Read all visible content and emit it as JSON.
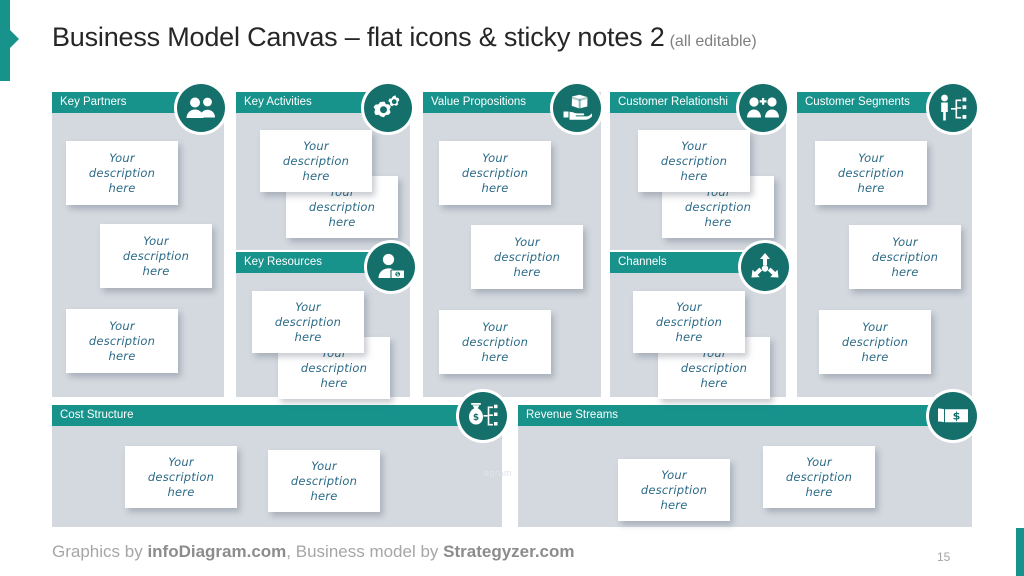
{
  "title": {
    "main": "Business Model Canvas – flat icons & sticky notes 2",
    "sub": "(all editable)"
  },
  "note_text": {
    "line1": "Your",
    "line2": "description",
    "line3": "here"
  },
  "colors": {
    "header_teal": "#18938c",
    "icon_teal": "#15706c",
    "block_gray": "#d4d9e0",
    "note_text": "#2b6a86",
    "title": "#262626",
    "footer": "#a6a6a6"
  },
  "blocks": [
    {
      "id": "key-partners",
      "label": "Key Partners",
      "icon": "two-people-icon"
    },
    {
      "id": "key-activities",
      "label": "Key Activities",
      "icon": "gears-icon"
    },
    {
      "id": "key-resources",
      "label": "Key Resources",
      "icon": "person-money-icon"
    },
    {
      "id": "value-propositions",
      "label": "Value Propositions",
      "icon": "hand-gift-box-icon"
    },
    {
      "id": "customer-relationships",
      "label": "Customer Relationshi",
      "icon": "people-plus-icon"
    },
    {
      "id": "channels",
      "label": "Channels",
      "icon": "arrows-distribution-icon"
    },
    {
      "id": "customer-segments",
      "label": "Customer Segments",
      "icon": "person-segments-icon"
    },
    {
      "id": "cost-structure",
      "label": "Cost Structure",
      "icon": "money-bag-tree-icon"
    },
    {
      "id": "revenue-streams",
      "label": "Revenue Streams",
      "icon": "banknote-dollar-icon"
    }
  ],
  "watermark": "agram",
  "footer": {
    "part1": "Graphics by ",
    "brand1": "infoDiagram.com",
    "part2": ", Business model by ",
    "brand2": "Strategyzer.com"
  },
  "page_number": "15"
}
